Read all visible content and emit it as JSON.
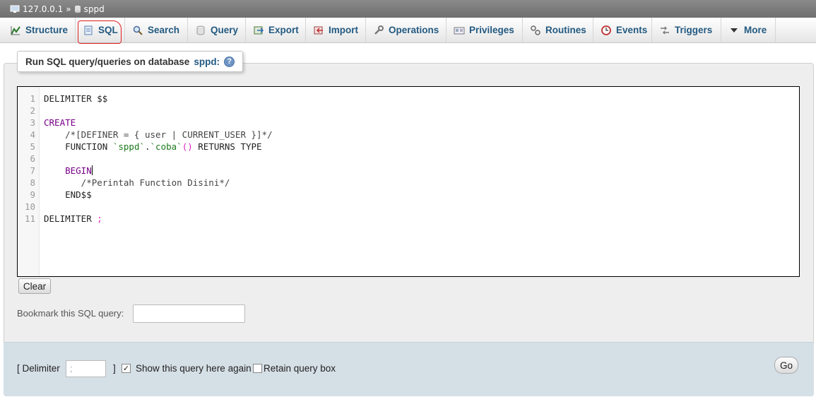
{
  "breadcrumb": {
    "server": "127.0.0.1",
    "separator": "»",
    "database": "sppd"
  },
  "tabs": [
    {
      "label": "Structure",
      "icon": "structure-icon"
    },
    {
      "label": "SQL",
      "icon": "sql-icon",
      "active": true
    },
    {
      "label": "Search",
      "icon": "search-icon"
    },
    {
      "label": "Query",
      "icon": "query-icon"
    },
    {
      "label": "Export",
      "icon": "export-icon"
    },
    {
      "label": "Import",
      "icon": "import-icon"
    },
    {
      "label": "Operations",
      "icon": "wrench-icon"
    },
    {
      "label": "Privileges",
      "icon": "privileges-icon"
    },
    {
      "label": "Routines",
      "icon": "routines-icon"
    },
    {
      "label": "Events",
      "icon": "clock-icon"
    },
    {
      "label": "Triggers",
      "icon": "triggers-icon"
    },
    {
      "label": "More",
      "icon": "chevron-down-icon"
    }
  ],
  "legend": {
    "prefix": "Run SQL query/queries on database",
    "database": "sppd:"
  },
  "editor": {
    "line_numbers": [
      "1",
      "2",
      "3",
      "4",
      "5",
      "6",
      "7",
      "8",
      "9",
      "10",
      "11"
    ]
  },
  "buttons": {
    "clear": "Clear",
    "go": "Go"
  },
  "bookmark": {
    "label": "Bookmark this SQL query:",
    "value": ""
  },
  "footer": {
    "delimiter_open": "[ Delimiter",
    "delimiter_value": ";",
    "delimiter_close": "]",
    "show_query_label": "Show this query here again",
    "show_query_checked": true,
    "retain_label": "Retain query box",
    "retain_checked": false
  },
  "colors": {
    "accent": "#235a81",
    "highlight": "#e02020",
    "footer_bg": "#d5dfe6"
  }
}
